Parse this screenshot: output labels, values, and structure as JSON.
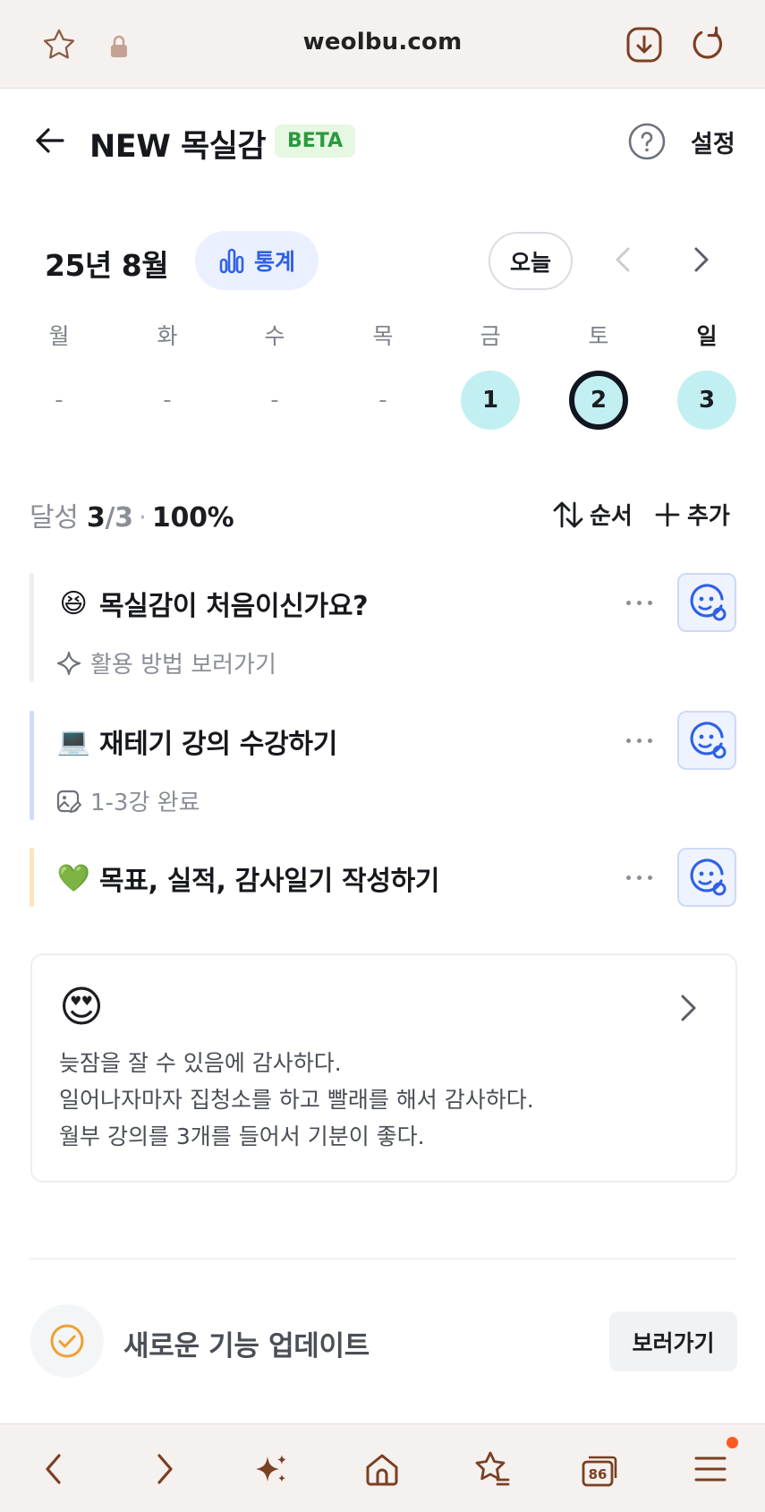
{
  "browser": {
    "url": "weolbu.com",
    "icons": [
      "star-outline-icon",
      "lock-icon",
      "download-icon",
      "reload-icon"
    ],
    "bottom_icons": [
      "back-arrow-icon",
      "forward-arrow-icon",
      "sparkle-icon",
      "home-icon",
      "bookmarks-icon",
      "tabs-icon",
      "menu-icon"
    ],
    "tab_count": "86"
  },
  "header": {
    "title": "NEW 목실감",
    "badge": "BETA",
    "settings_label": "설정"
  },
  "calendar": {
    "month_label": "25년 8월",
    "stats_label": "통계",
    "today_label": "오늘",
    "weekdays": [
      "월",
      "화",
      "수",
      "목",
      "금",
      "토",
      "일"
    ],
    "days": [
      "-",
      "-",
      "-",
      "-",
      "1",
      "2",
      "3"
    ],
    "completed_days": [
      "1",
      "2",
      "3"
    ],
    "selected_day": "2"
  },
  "summary": {
    "label": "달성",
    "done": "3",
    "total": "/3",
    "separator": "·",
    "percent": "100%",
    "order_label": "순서",
    "add_label": "추가"
  },
  "habits": [
    {
      "emoji": "😆",
      "title": "목실감이 처음이신가요?",
      "sub": "활용 방법 보러가기",
      "sub_icon": "sparkle-outline-icon",
      "bar_color": "#eeeeef"
    },
    {
      "emoji": "💻",
      "title": "재테기 강의 수강하기",
      "sub": "1-3강 완료",
      "sub_icon": "image-edit-icon",
      "bar_color": "#cfddfb"
    },
    {
      "emoji": "💚",
      "title": "목표, 실적, 감사일기 작성하기",
      "bar_color": "#fde3bf"
    }
  ],
  "diary": {
    "emoji": "😍",
    "lines": [
      "늦잠을 잘 수 있음에 감사하다.",
      "일어나자마자 집청소를 하고 빨래를 해서 감사하다.",
      "월부 강의를 3개를 들어서 기분이 좋다."
    ]
  },
  "update": {
    "text": "새로운 기능 업데이트",
    "button_label": "보러가기"
  },
  "colors": {
    "accent_blue": "#2f61e6",
    "done_day": "#c2f0f2",
    "beta_green": "#2a9a3e",
    "update_orange": "#f0a030",
    "notification": "#ff5a1f"
  }
}
